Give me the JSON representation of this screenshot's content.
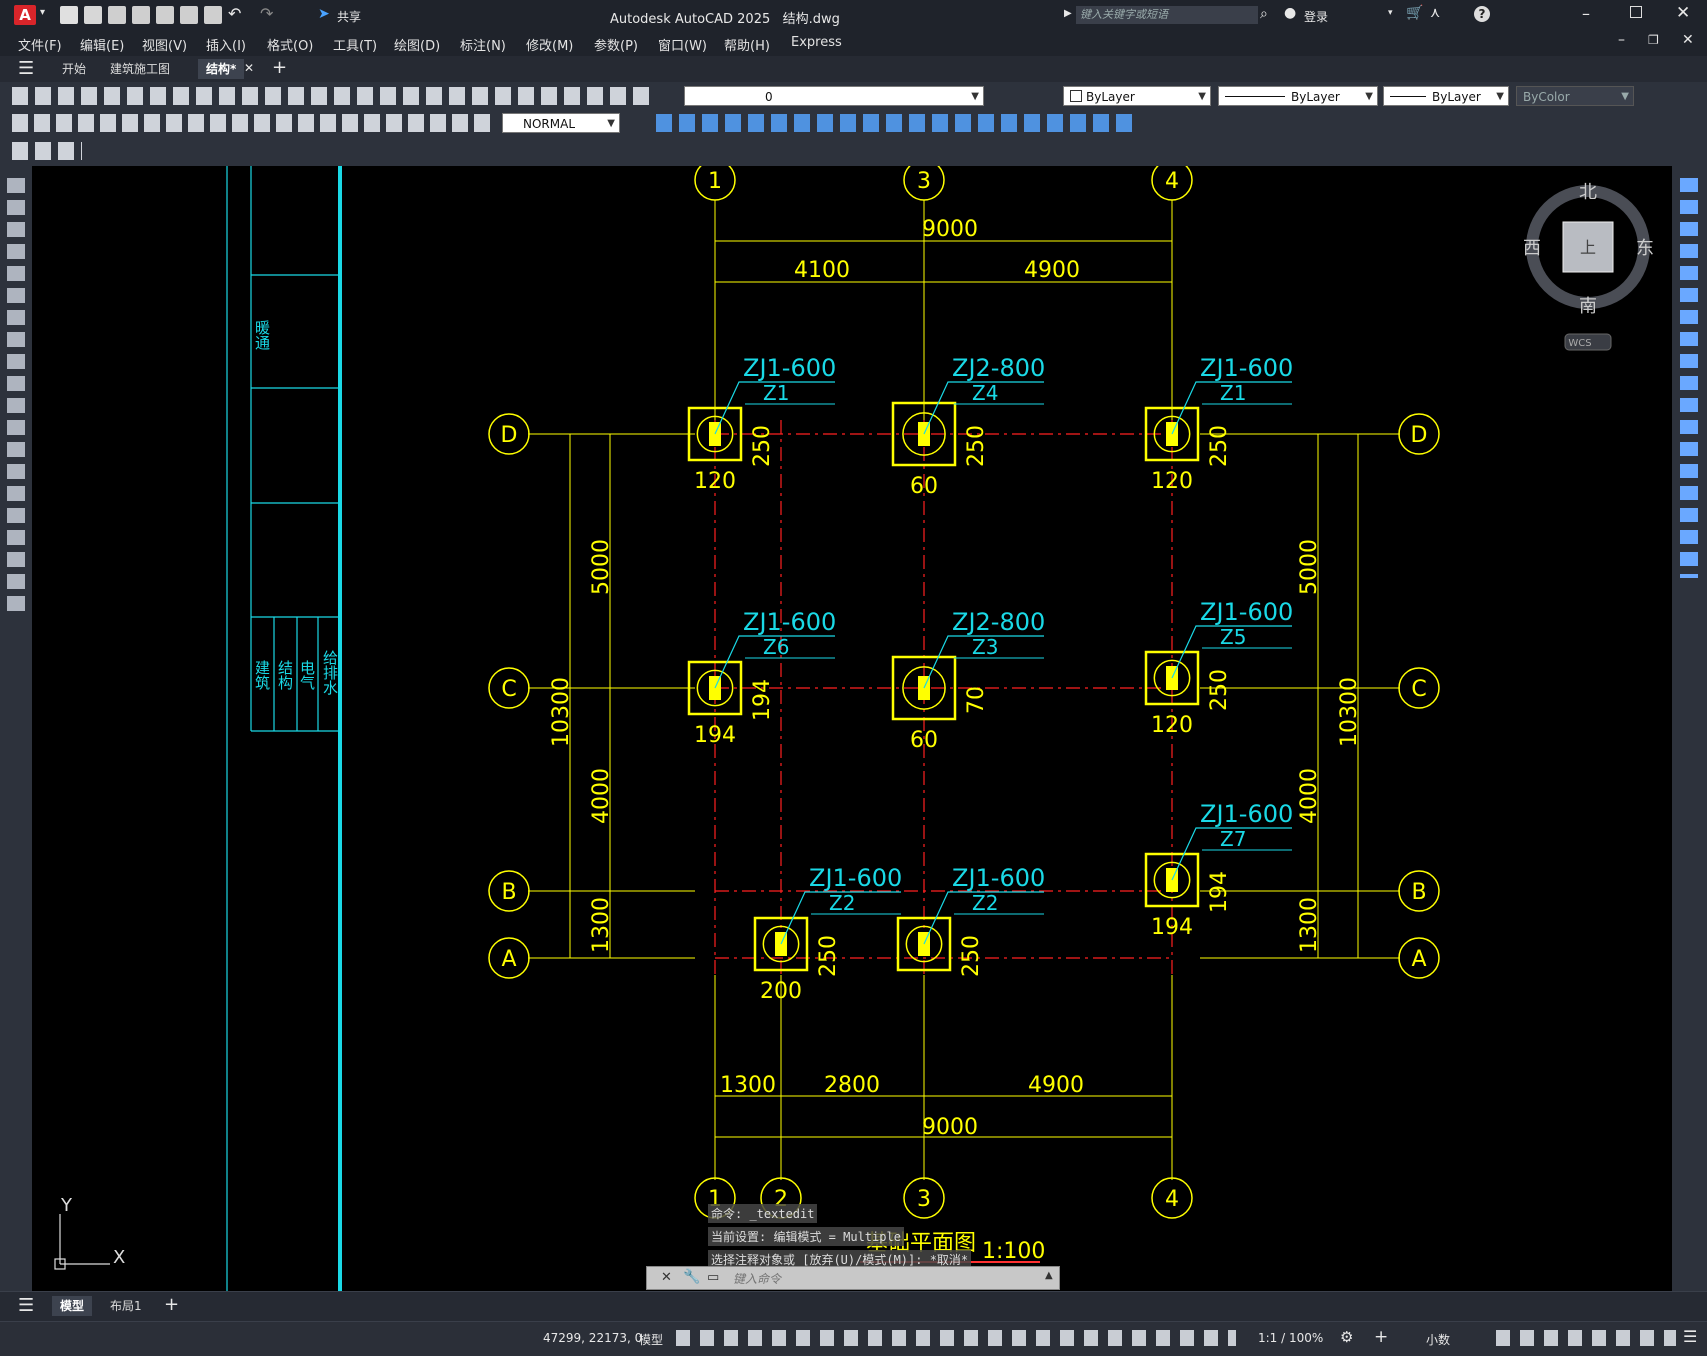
{
  "app": {
    "title": "Autodesk AutoCAD 2025",
    "filename": "结构.dwg",
    "logo": "A",
    "share": "共享",
    "search_placeholder": "键入关键字或短语",
    "login": "登录"
  },
  "menu": [
    "文件(F)",
    "编辑(E)",
    "视图(V)",
    "插入(I)",
    "格式(O)",
    "工具(T)",
    "绘图(D)",
    "标注(N)",
    "修改(M)",
    "参数(P)",
    "窗口(W)",
    "帮助(H)",
    "Express"
  ],
  "doc_tabs": [
    "开始",
    "建筑施工图",
    "结构*"
  ],
  "layer": {
    "current": "0"
  },
  "properties": {
    "color": "ByLayer",
    "linetype": "ByLayer",
    "lineweight": "ByLayer",
    "plotstyle": "ByColor"
  },
  "style_combo": "NORMAL",
  "viewcube": {
    "north": "北",
    "south": "南",
    "east": "东",
    "west": "西",
    "top": "上",
    "wcs": "WCS"
  },
  "ucs": {
    "x": "X",
    "y": "Y"
  },
  "drawing": {
    "axes_top": [
      "1",
      "3",
      "4"
    ],
    "axes_bottom": [
      "1",
      "2",
      "3",
      "4"
    ],
    "axes_rows": [
      "D",
      "C",
      "B",
      "A"
    ],
    "dim_top_total": "9000",
    "dim_top_parts": [
      "4100",
      "4900"
    ],
    "dim_bottom_parts": [
      "1300",
      "2800",
      "4900"
    ],
    "dim_bottom_total": "9000",
    "dim_left_parts": [
      "5000",
      "4000",
      "1300"
    ],
    "dim_left_total": "10300",
    "dim_right_parts": [
      "5000",
      "4000",
      "1300"
    ],
    "dim_right_total": "10300",
    "footings": [
      {
        "tag": "ZJ1-600",
        "col": "Z1",
        "offset_x": "120",
        "offset_y": "250"
      },
      {
        "tag": "ZJ2-800",
        "col": "Z4",
        "offset_x": "60",
        "offset_y": "250"
      },
      {
        "tag": "ZJ1-600",
        "col": "Z1",
        "offset_x": "120",
        "offset_y": "250"
      },
      {
        "tag": "ZJ1-600",
        "col": "Z6",
        "offset_x": "194",
        "offset_y": "194"
      },
      {
        "tag": "ZJ2-800",
        "col": "Z3",
        "offset_x": "60",
        "offset_y": "70"
      },
      {
        "tag": "ZJ1-600",
        "col": "Z5",
        "offset_x": "120",
        "offset_y": "250"
      },
      {
        "tag": "ZJ1-600",
        "col": "Z7",
        "offset_x": "194",
        "offset_y": "194"
      },
      {
        "tag": "ZJ1-600",
        "col": "Z2",
        "offset_x": "200",
        "offset_y": "250"
      },
      {
        "tag": "ZJ1-600",
        "col": "Z2",
        "offset_x": "",
        "offset_y": "250"
      }
    ],
    "plan_title": "基础平面图",
    "plan_scale": "1:100",
    "legend_header": "暖通",
    "legend_rows": [
      "建筑",
      "结构",
      "电气",
      "给排水"
    ]
  },
  "command": {
    "history": [
      "命令: _textedit",
      "当前设置: 编辑模式 = Multiple",
      "选择注释对象或 [放弃(U)/模式(M)]: *取消*"
    ],
    "placeholder": "键入命令"
  },
  "layout_tabs": [
    "模型",
    "布局1"
  ],
  "status": {
    "coords": "47299, 22173, 0",
    "space": "模型",
    "scale": "1:1 / 100%",
    "units": "小数"
  }
}
